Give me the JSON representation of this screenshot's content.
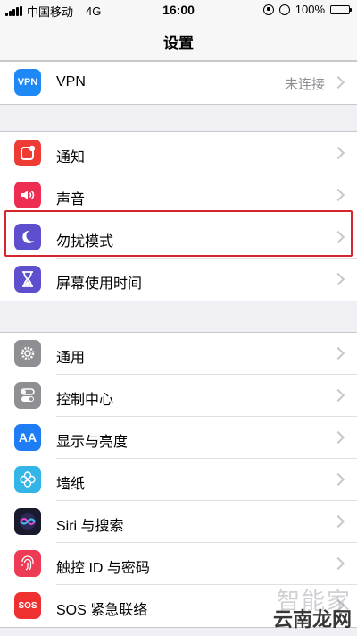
{
  "status_bar": {
    "carrier": "中国移动",
    "network": "4G",
    "time": "16:00",
    "battery": "100%",
    "battery_level": 1.0
  },
  "nav": {
    "title": "设置"
  },
  "group1": [
    {
      "label": "VPN",
      "value": "未连接",
      "icon": "vpn-icon",
      "icon_text": "VPN",
      "color": "#1e88f5"
    }
  ],
  "group2": [
    {
      "label": "通知",
      "icon": "notifications-icon",
      "color": "#ee3b33"
    },
    {
      "label": "声音",
      "icon": "sounds-icon",
      "color": "#ee2d52"
    },
    {
      "label": "勿扰模式",
      "icon": "moon-icon",
      "color": "#5e4fcf"
    },
    {
      "label": "屏幕使用时间",
      "icon": "hourglass-icon",
      "color": "#5e4fcf"
    }
  ],
  "group3": [
    {
      "label": "通用",
      "icon": "gear-icon",
      "color": "#8e8e93"
    },
    {
      "label": "控制中心",
      "icon": "toggles-icon",
      "color": "#8e8e93"
    },
    {
      "label": "显示与亮度",
      "icon": "text-size-icon",
      "icon_text": "AA",
      "color": "#1e7cf5"
    },
    {
      "label": "墙纸",
      "icon": "flower-icon",
      "color": "#34b5e8"
    },
    {
      "label": "Siri 与搜索",
      "icon": "siri-icon",
      "color": "#1a1a2e"
    },
    {
      "label": "触控 ID 与密码",
      "icon": "fingerprint-icon",
      "color": "#ee3b55"
    },
    {
      "label": "SOS 紧急联络",
      "icon": "sos-icon",
      "icon_text": "SOS",
      "color": "#ee3030"
    }
  ],
  "watermark": {
    "line1": "智能家",
    "line2": "云南龙网"
  },
  "colors": {
    "highlight": "#d6252b",
    "background": "#efeff4"
  }
}
